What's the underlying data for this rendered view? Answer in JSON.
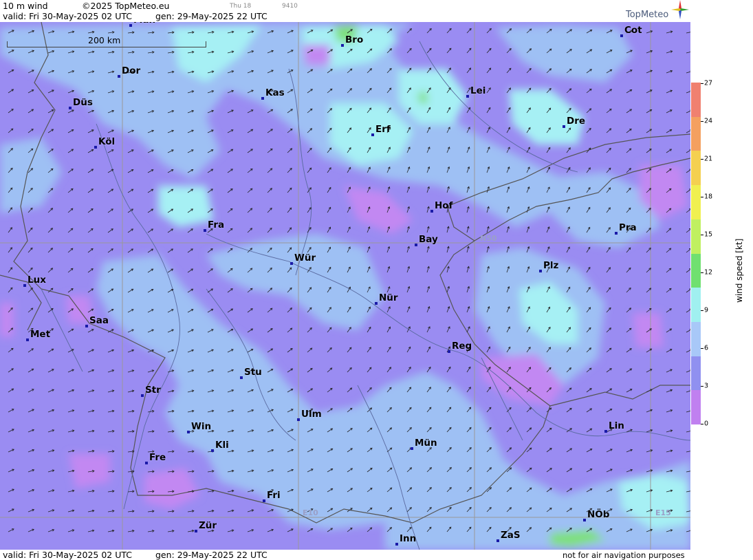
{
  "header": {
    "parameter": "10 m wind",
    "copyright": "©2025 TopMeteo.eu",
    "day_tag": "Thu 18",
    "code_tag": "9410",
    "valid": "valid:  Fri  30-May-2025  02 UTC",
    "gen": "gen: 29-May-2025 22 UTC",
    "brand": "TopMeteo"
  },
  "footer": {
    "valid": "valid:  Fri  30-May-2025  02 UTC",
    "gen": "gen: 29-May-2025 22 UTC",
    "disclaimer": "not for air navigation purposes"
  },
  "scale": {
    "label": "200 km"
  },
  "grid_labels": {
    "n50": "N50",
    "e10": "E10",
    "e15": "E15"
  },
  "cities": [
    {
      "name": "Man"
    },
    {
      "name": "Bro"
    },
    {
      "name": "Cot"
    },
    {
      "name": "Dor"
    },
    {
      "name": "Kas"
    },
    {
      "name": "Lei"
    },
    {
      "name": "Düs"
    },
    {
      "name": "Erf"
    },
    {
      "name": "Dre"
    },
    {
      "name": "Köl"
    },
    {
      "name": "Hof"
    },
    {
      "name": "Fra"
    },
    {
      "name": "Bay"
    },
    {
      "name": "Pra"
    },
    {
      "name": "Würz"
    },
    {
      "name": "Plz"
    },
    {
      "name": "Lux"
    },
    {
      "name": "Nür"
    },
    {
      "name": "Saa"
    },
    {
      "name": "Met"
    },
    {
      "name": "Reg"
    },
    {
      "name": "Stu"
    },
    {
      "name": "Str"
    },
    {
      "name": "Ulm"
    },
    {
      "name": "Win"
    },
    {
      "name": "Lin"
    },
    {
      "name": "Kli"
    },
    {
      "name": "Mün"
    },
    {
      "name": "Fre"
    },
    {
      "name": "Fri"
    },
    {
      "name": "NÖb"
    },
    {
      "name": "Zür"
    },
    {
      "name": "Inn"
    },
    {
      "name": "ZaS"
    }
  ],
  "legend": {
    "title": "wind speed [kt]",
    "ticks": [
      "27",
      "24",
      "21",
      "18",
      "15",
      "12",
      "9",
      "6",
      "3",
      "0"
    ],
    "colors": [
      "#f08070",
      "#f4a060",
      "#f4d050",
      "#f0f050",
      "#c0f060",
      "#70e070",
      "#a0f0f0",
      "#a8c8f8",
      "#9090f0",
      "#c080f0"
    ]
  },
  "palette": {
    "c0_3": "#c288f2",
    "c3_6": "#9a8cf2",
    "c6_9": "#9ec0f4",
    "c9_12": "#a6f0f4",
    "c12_15": "#7ee07a",
    "border": "#555555",
    "river": "#5a6aa0",
    "grid": "#999999",
    "city_dot": "#1a1aa8"
  }
}
